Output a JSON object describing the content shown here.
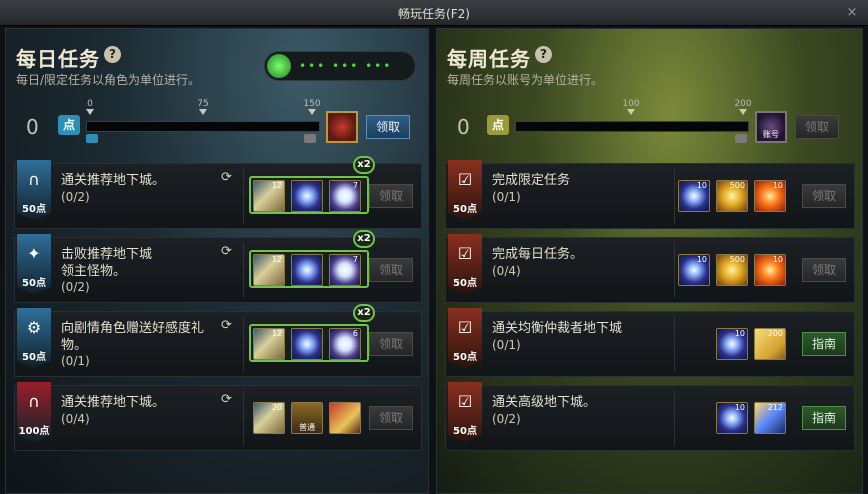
{
  "window": {
    "title": "畅玩任务(F2)",
    "close_label": "×"
  },
  "daily": {
    "title": "每日任务",
    "help_label": "?",
    "subtitle": "每日/限定任务以角色为单位进行。",
    "timer_dots": "••• ••• •••",
    "points": "0",
    "points_icon": "点",
    "progress_fraction": 0,
    "ticks": [
      "0",
      "75",
      "150"
    ],
    "claim_label": "领取",
    "tasks": [
      {
        "name": "通关推荐地下城。",
        "progress": "(0/2)",
        "points": "50点",
        "color": "blue",
        "icon": "gate-icon",
        "multiplier": "x2",
        "rewards": [
          {
            "type": "scroll",
            "count": "12"
          },
          {
            "type": "orb-blue",
            "count": ""
          },
          {
            "type": "orb-white",
            "count": "7"
          }
        ],
        "button": "领取"
      },
      {
        "name": "击败推荐地下城\n领主怪物。",
        "progress": "(0/2)",
        "points": "50点",
        "color": "blue",
        "icon": "sword-icon",
        "multiplier": "x2",
        "rewards": [
          {
            "type": "scroll",
            "count": "12"
          },
          {
            "type": "orb-blue",
            "count": ""
          },
          {
            "type": "orb-white",
            "count": "7"
          }
        ],
        "button": "领取"
      },
      {
        "name": "向剧情角色赠送好感度礼\n物。",
        "progress": "(0/1)",
        "points": "50点",
        "color": "blue",
        "icon": "gift-icon",
        "multiplier": "x2",
        "rewards": [
          {
            "type": "scroll",
            "count": "12"
          },
          {
            "type": "orb-blue",
            "count": ""
          },
          {
            "type": "orb-white",
            "count": "6"
          }
        ],
        "button": "领取"
      },
      {
        "name": "通关推荐地下城。",
        "progress": "(0/4)",
        "points": "100点",
        "color": "red",
        "icon": "gate-icon",
        "multiplier": "",
        "rewards": [
          {
            "type": "scroll",
            "count": "20"
          },
          {
            "type": "chest",
            "count": "",
            "label": "普通"
          },
          {
            "type": "box",
            "count": ""
          }
        ],
        "button": "领取"
      }
    ]
  },
  "weekly": {
    "title": "每周任务",
    "help_label": "?",
    "subtitle": "每周任务以账号为单位进行。",
    "points": "0",
    "points_icon": "点",
    "progress_fraction": 0,
    "ticks": [
      "100",
      "200"
    ],
    "reward_label": "账号",
    "claim_label": "领取",
    "tasks": [
      {
        "name": "完成限定任务",
        "progress": "(0/1)",
        "points": "50点",
        "rewards": [
          {
            "type": "orb-blue",
            "count": "10"
          },
          {
            "type": "gold",
            "count": "500"
          },
          {
            "type": "fire",
            "count": "10"
          }
        ],
        "button": "领取",
        "button_style": "disabled"
      },
      {
        "name": "完成每日任务。",
        "progress": "(0/4)",
        "points": "50点",
        "rewards": [
          {
            "type": "orb-blue",
            "count": "10"
          },
          {
            "type": "gold",
            "count": "500"
          },
          {
            "type": "fire",
            "count": "10"
          }
        ],
        "button": "领取",
        "button_style": "disabled"
      },
      {
        "name": "通关均衡仲裁者地下城",
        "progress": "(0/1)",
        "points": "50点",
        "rewards": [
          {
            "type": "orb-blue",
            "count": "10"
          },
          {
            "type": "card",
            "count": "200"
          }
        ],
        "button": "指南",
        "button_style": "guide"
      },
      {
        "name": "通关高级地下城。",
        "progress": "(0/2)",
        "points": "50点",
        "rewards": [
          {
            "type": "orb-blue",
            "count": "10"
          },
          {
            "type": "sky",
            "count": "212"
          }
        ],
        "button": "指南",
        "button_style": "guide"
      }
    ]
  },
  "colors": {
    "daily_badge": "#2f6f9a",
    "weekly_badge": "#8a2f1e",
    "daily_red_badge": "#9a1f2a",
    "accent_green": "#6fc24a"
  }
}
